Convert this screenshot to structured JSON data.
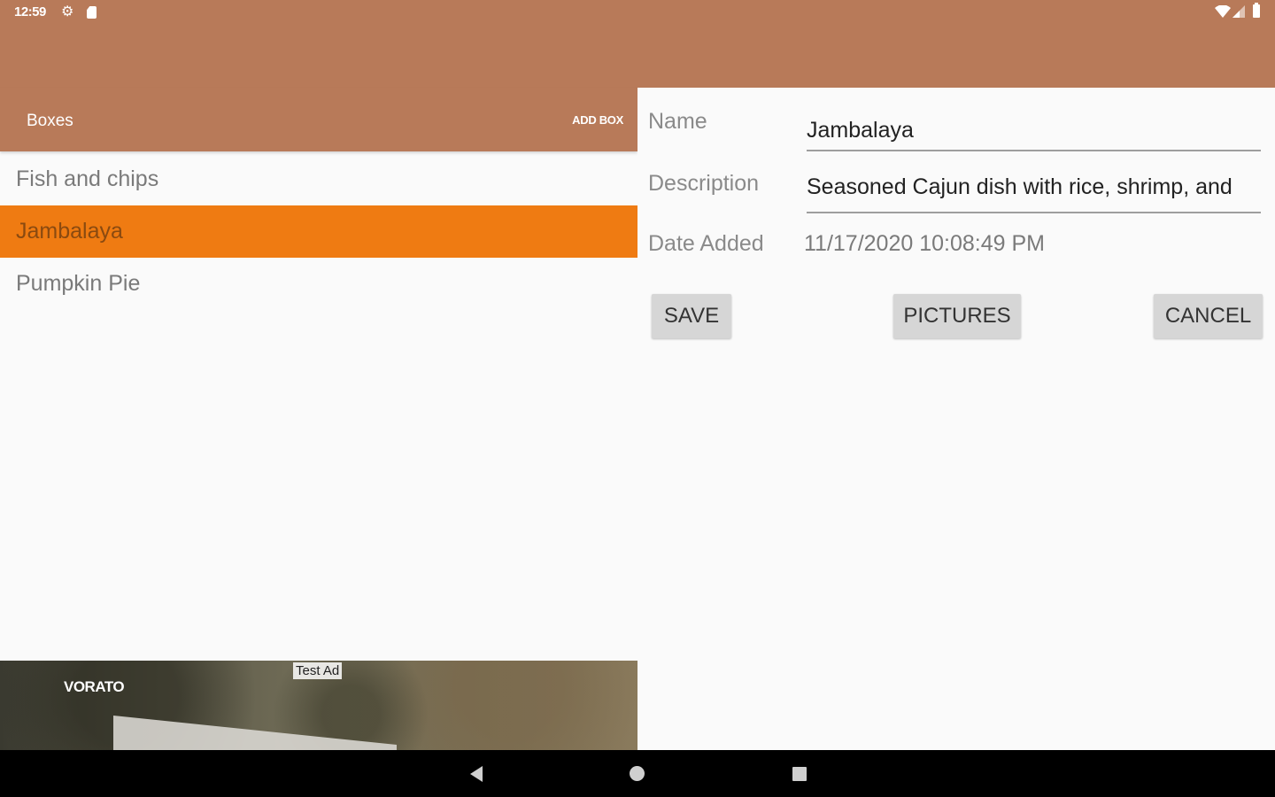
{
  "status_bar": {
    "time": "12:59"
  },
  "toolbar": {
    "title": "Boxes",
    "add_label": "ADD BOX",
    "color": "#b87a59"
  },
  "list": {
    "items": [
      {
        "label": "Fish and chips",
        "selected": false
      },
      {
        "label": "Jambalaya",
        "selected": true
      },
      {
        "label": "Pumpkin Pie",
        "selected": false
      }
    ],
    "selected_color": "#ef7b12"
  },
  "ad": {
    "brand": "VORATO",
    "label": "Test Ad"
  },
  "detail": {
    "name_label": "Name",
    "name_value": "Jambalaya",
    "description_label": "Description",
    "description_value": "Seasoned Cajun dish with rice, shrimp, and",
    "date_label": "Date Added",
    "date_value": "11/17/2020 10:08:49 PM",
    "save_label": "SAVE",
    "pictures_label": "PICTURES",
    "cancel_label": "CANCEL"
  },
  "icons": {
    "settings": "gear-icon",
    "sd_card": "sd-card-icon",
    "wifi": "wifi-icon",
    "signal": "signal-icon",
    "battery": "battery-icon",
    "back": "back-icon",
    "home": "home-icon",
    "recents": "recents-icon"
  }
}
